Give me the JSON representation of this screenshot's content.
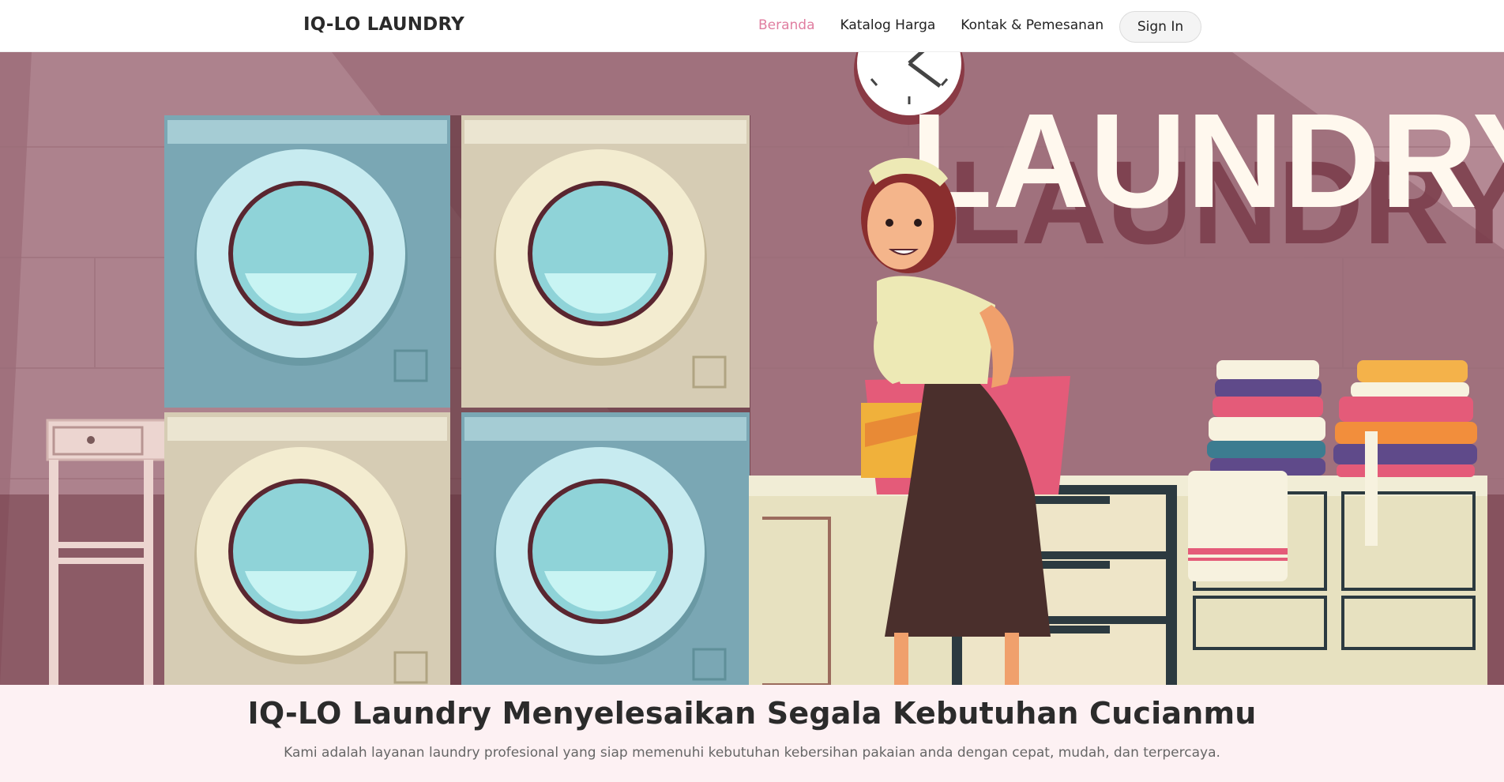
{
  "navbar": {
    "brand": "IQ-LO LAUNDRY",
    "links": [
      {
        "label": "Beranda",
        "active": true
      },
      {
        "label": "Katalog Harga",
        "active": false
      },
      {
        "label": "Kontak & Pemesanan",
        "active": false
      }
    ],
    "sign_in_label": "Sign In"
  },
  "hero": {
    "illustration_text": "LAUNDRY",
    "illustration_subject": "laundry-room-illustration"
  },
  "tagline": {
    "headline": "IQ-LO Laundry Menyelesaikan Segala Kebutuhan Cucianmu",
    "subline": "Kami adalah layanan laundry profesional yang siap memenuhi kebutuhan kebersihan pakaian anda dengan cepat, mudah, dan terpercaya."
  },
  "colors": {
    "accent": "#e07ea0",
    "hero_background": "#a97c87",
    "band_background": "#fdf1f3"
  }
}
